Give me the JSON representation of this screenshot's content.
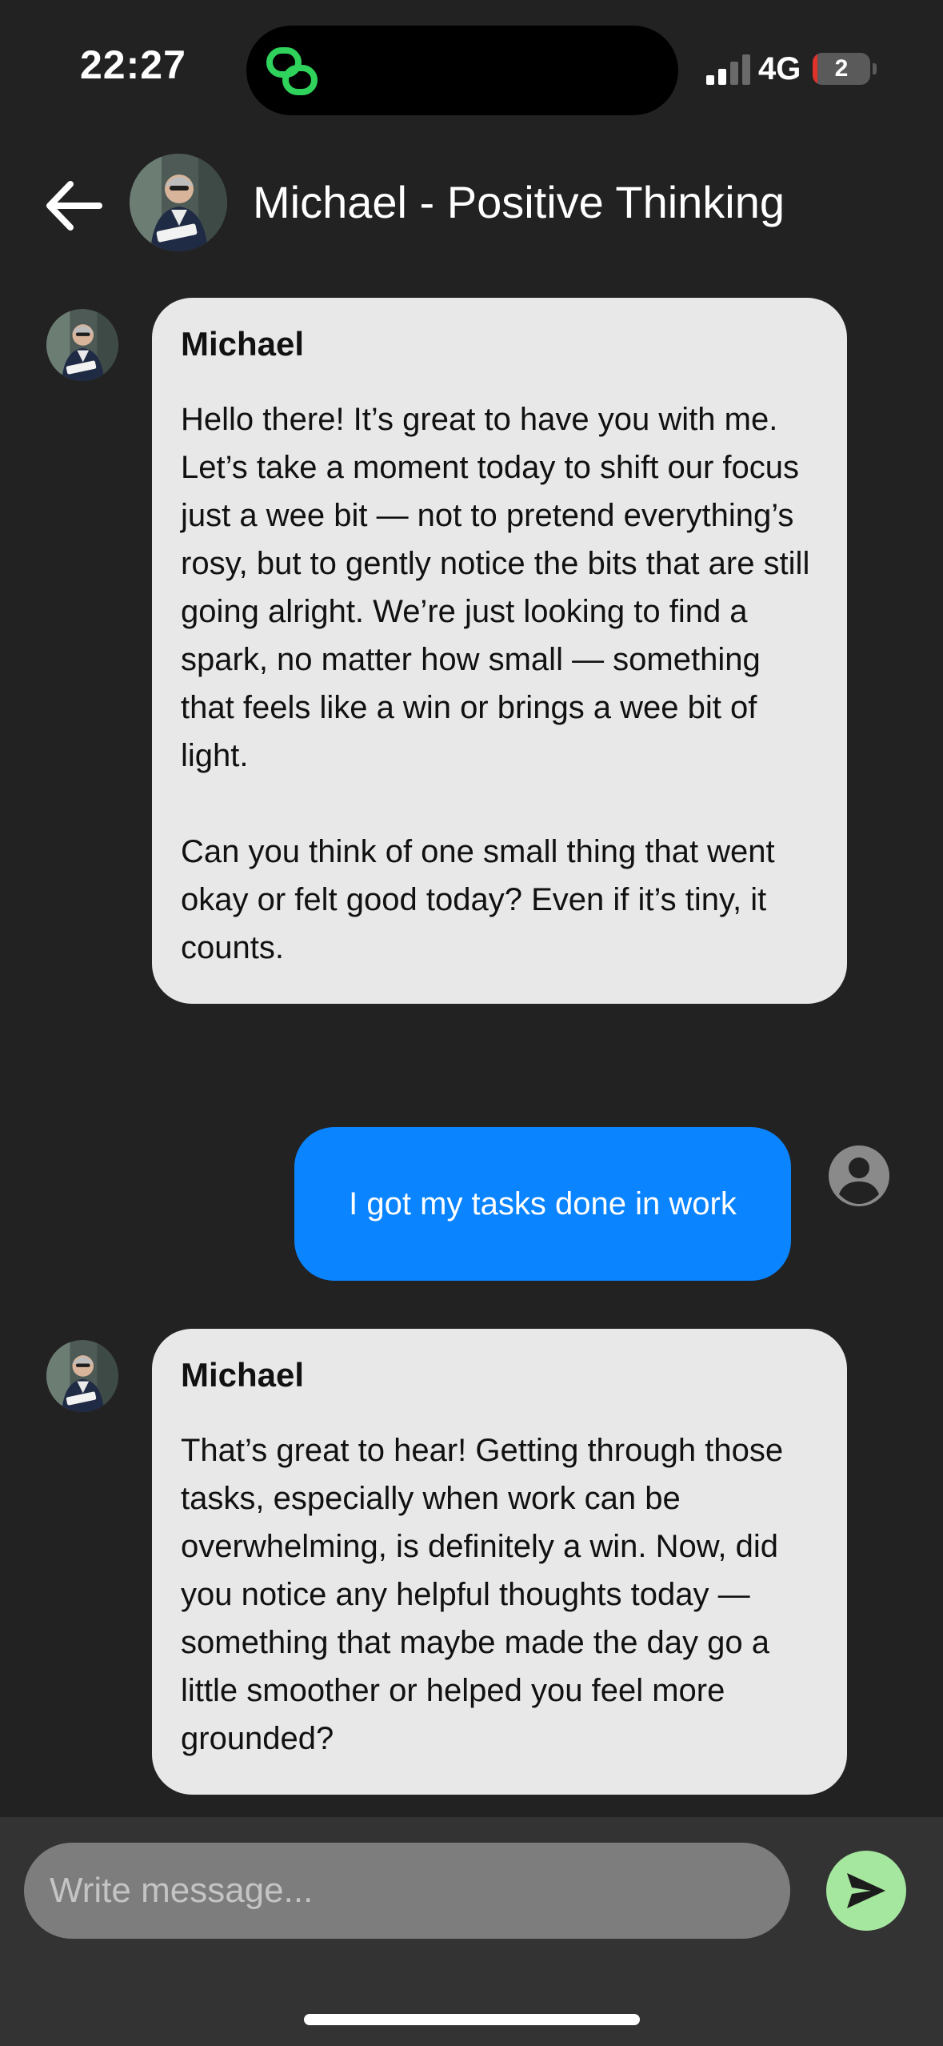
{
  "status_bar": {
    "time": "22:27",
    "network": "4G",
    "battery_level": "2",
    "battery_fraction": 0.03,
    "app_icon": "link-chain-icon",
    "signal_bars": 2
  },
  "header": {
    "back_icon": "arrow-left-icon",
    "avatar": "profile-photo",
    "title": "Michael - Positive Thinking"
  },
  "messages": [
    {
      "from": "bot",
      "sender": "Michael",
      "text": "Hello there! It’s great to have you with me. Let’s take a moment today to shift our focus just a wee bit — not to pretend everything’s rosy, but to gently notice the bits that are still going alright. We’re just looking to find a spark, no matter how small — something that feels like a win or brings a wee bit of light.\n\nCan you think of one small thing that went okay or felt good today? Even if it’s tiny, it counts."
    },
    {
      "from": "user",
      "text": "I got my tasks done in work"
    },
    {
      "from": "bot",
      "sender": "Michael",
      "text": "That’s great to hear! Getting through those tasks, especially when work can be overwhelming, is definitely a win. Now, did you notice any helpful thoughts today — something that maybe made the day go a little smoother or helped you feel more grounded?"
    }
  ],
  "composer": {
    "placeholder": "Write message...",
    "value": "",
    "send_icon": "send-arrow-icon"
  },
  "colors": {
    "background": "#222222",
    "bot_bubble": "#e8e8e8",
    "user_bubble": "#0a84ff",
    "send_button": "#a6e7a0",
    "input_bar": "#333333"
  }
}
